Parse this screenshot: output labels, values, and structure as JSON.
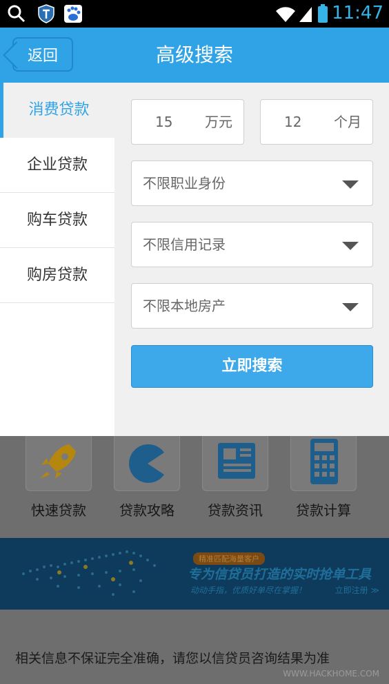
{
  "status_bar": {
    "time": "11:47",
    "icons": [
      "search-icon",
      "shield-app-icon",
      "baidu-app-icon",
      "wifi-icon",
      "signal-icon",
      "battery-icon"
    ]
  },
  "header": {
    "back_label": "返回",
    "title": "高级搜索"
  },
  "tabs": [
    {
      "label": "消费贷款",
      "active": true
    },
    {
      "label": "企业贷款",
      "active": false
    },
    {
      "label": "购车贷款",
      "active": false
    },
    {
      "label": "购房贷款",
      "active": false
    }
  ],
  "form": {
    "amount": {
      "value": "15",
      "unit": "万元"
    },
    "term": {
      "value": "12",
      "unit": "个月"
    },
    "selects": [
      {
        "label": "不限职业身份"
      },
      {
        "label": "不限信用记录"
      },
      {
        "label": "不限本地房产"
      }
    ],
    "search_label": "立即搜索"
  },
  "quick_links": [
    {
      "label": "快速贷款",
      "icon": "rocket-icon"
    },
    {
      "label": "贷款攻略",
      "icon": "pacman-icon"
    },
    {
      "label": "贷款资讯",
      "icon": "news-icon"
    },
    {
      "label": "贷款计算",
      "icon": "calculator-icon"
    }
  ],
  "banner": {
    "tag": "精准匹配海量客户",
    "headline": "专为信贷员打造的实时抢单工具",
    "sub": "动动手指，优质好单尽在掌握！",
    "register": "立即注册 ≫"
  },
  "disclaimer": "相关信息不保证完全准确，请您以信贷员咨询结果为准",
  "watermark": "WWW.HACKHOME.COM",
  "colors": {
    "accent": "#2fa3e6",
    "overlay": "#6e6e6e"
  }
}
